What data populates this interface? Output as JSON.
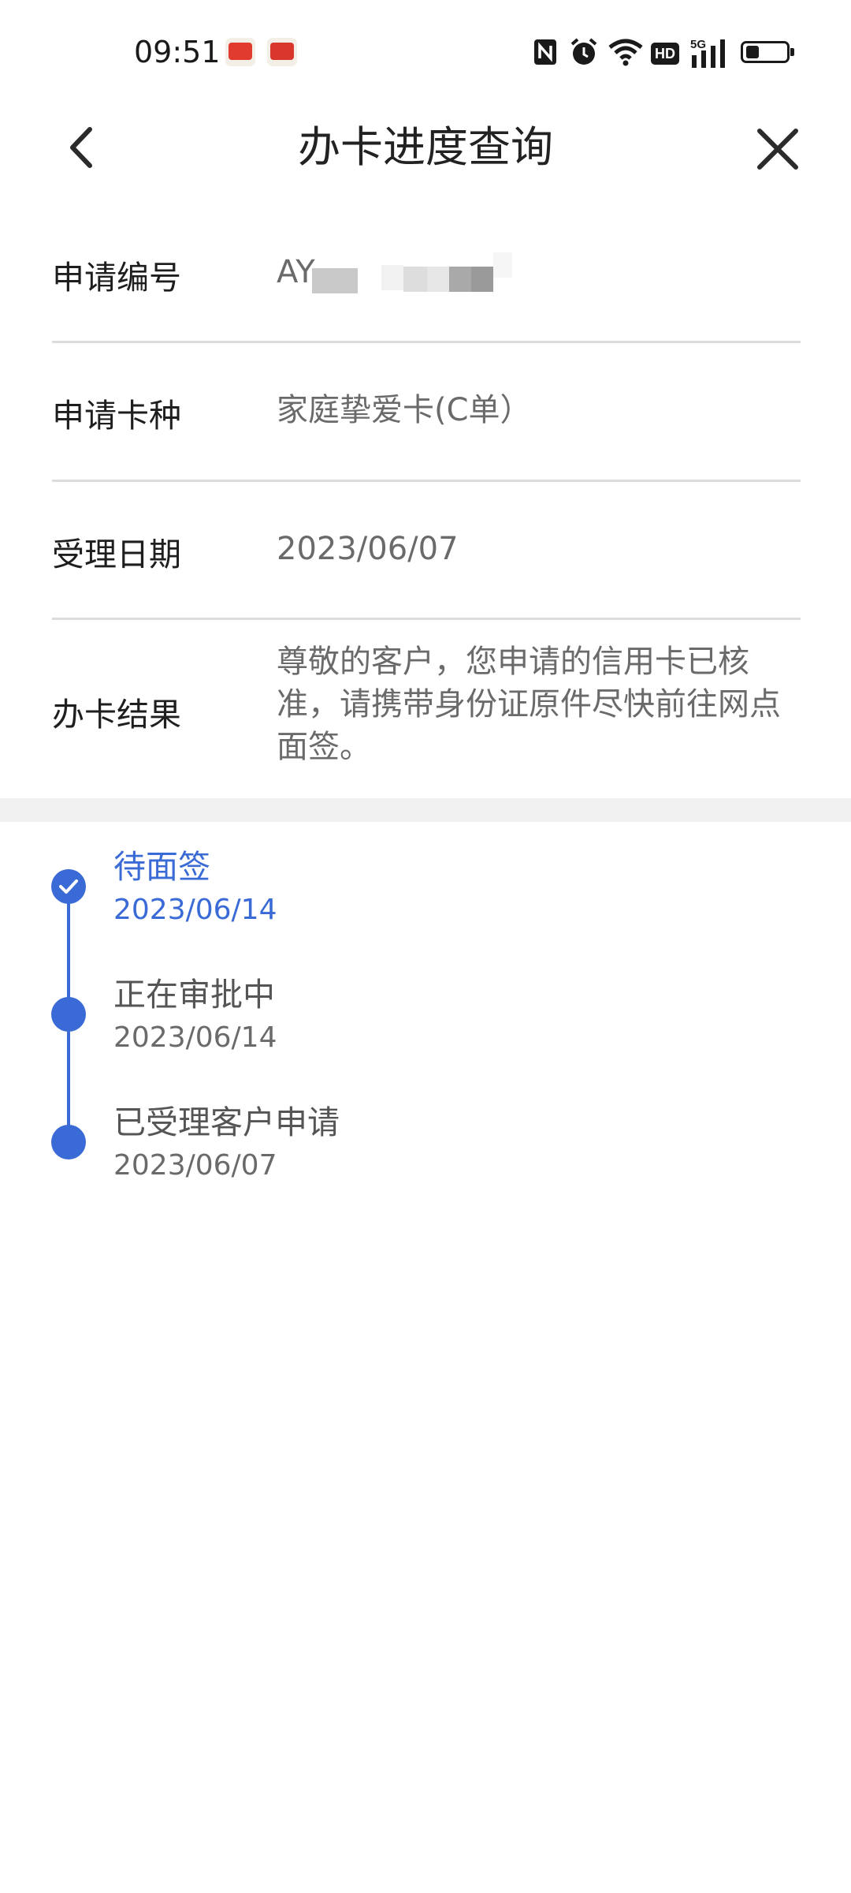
{
  "status_bar": {
    "time": "09:51",
    "icons": [
      "app-badge-icon",
      "app-badge-icon",
      "nfc-icon",
      "alarm-icon",
      "wifi-icon",
      "hd-icon",
      "signal-5g-icon",
      "battery-icon"
    ],
    "hd_label": "HD",
    "network_label": "5G"
  },
  "nav": {
    "title": "办卡进度查询",
    "back_icon": "chevron-left-icon",
    "close_icon": "close-icon"
  },
  "info": {
    "app_no_label": "申请编号",
    "app_no_value": "AY",
    "card_type_label": "申请卡种",
    "card_type_value": "家庭挚爱卡(C单）",
    "date_label": "受理日期",
    "date_value": "2023/06/07",
    "result_label": "办卡结果",
    "result_value": "尊敬的客户，您申请的信用卡已核准，请携带身份证原件尽快前往网点面签。"
  },
  "timeline": [
    {
      "title": "待面签",
      "date": "2023/06/14",
      "state": "current"
    },
    {
      "title": "正在审批中",
      "date": "2023/06/14",
      "state": "done"
    },
    {
      "title": "已受理客户申请",
      "date": "2023/06/07",
      "state": "done"
    }
  ],
  "colors": {
    "accent": "#3a6ad6",
    "divider": "#dcdcdc",
    "section_gap": "#f0f0f0"
  }
}
